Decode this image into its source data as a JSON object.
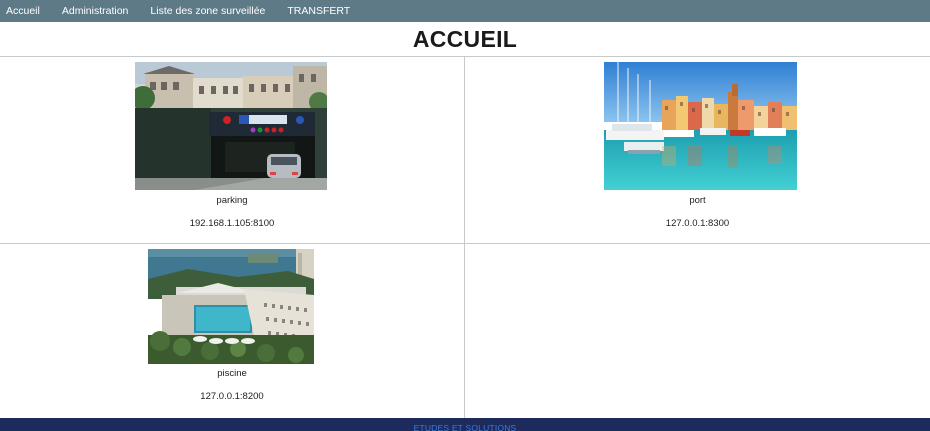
{
  "nav": {
    "items": [
      {
        "label": "Accueil"
      },
      {
        "label": "Administration"
      },
      {
        "label": "Liste des zone surveillée"
      },
      {
        "label": "TRANSFERT"
      }
    ],
    "bar_color": "#5e7a87"
  },
  "page": {
    "title": "ACCUEIL"
  },
  "cameras": [
    {
      "name": "parking",
      "address": "192.168.1.105:8100"
    },
    {
      "name": "port",
      "address": "127.0.0.1:8300"
    },
    {
      "name": "piscine",
      "address": "127.0.0.1:8200"
    }
  ],
  "footer": {
    "text": "ETUDES ET SOLUTIONS",
    "bg_color": "#1c2a5c",
    "text_color": "#3b7bd6"
  }
}
